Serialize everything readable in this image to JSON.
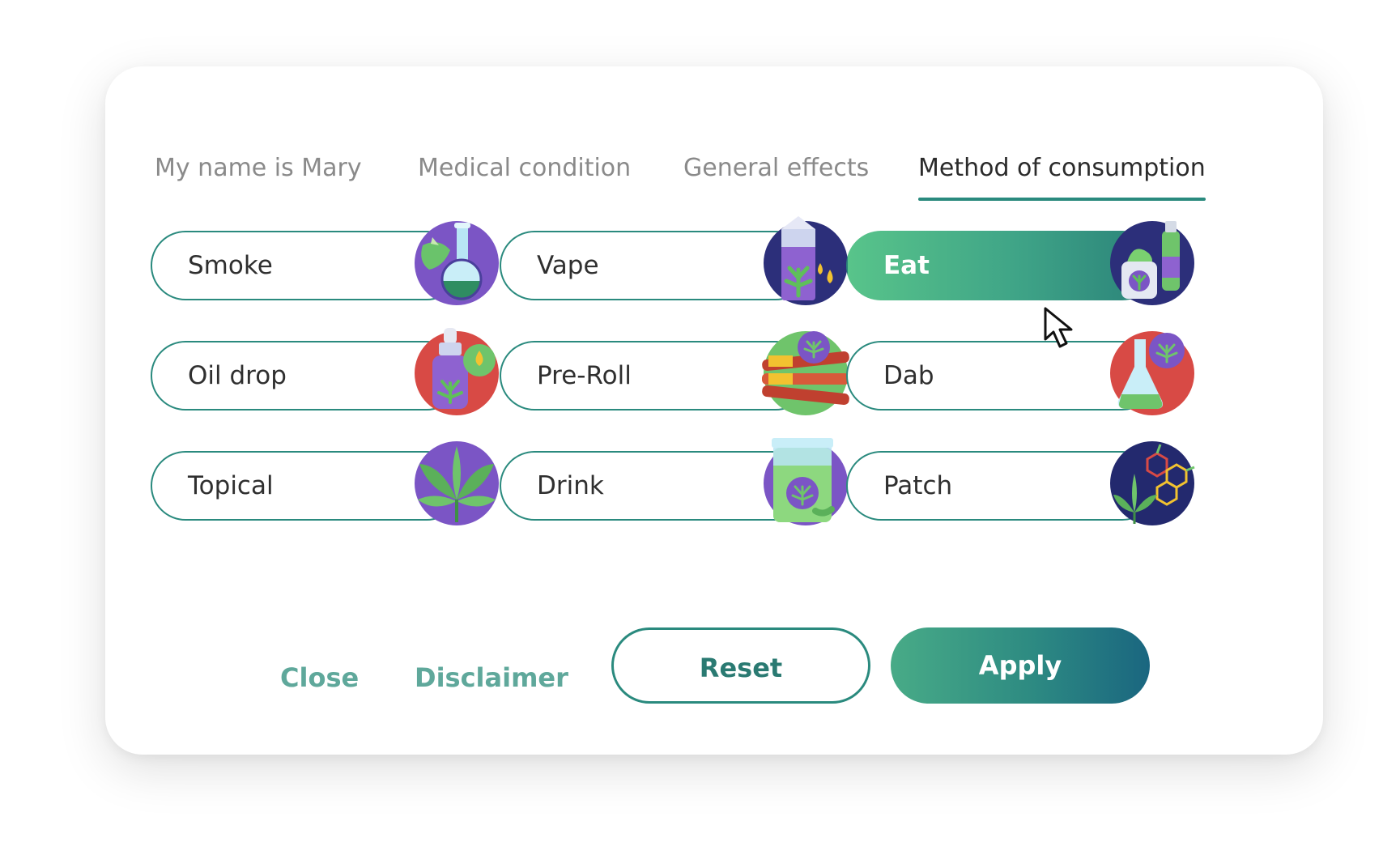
{
  "tabs": [
    {
      "label": "My name is Mary",
      "active": false
    },
    {
      "label": "Medical condition",
      "active": false
    },
    {
      "label": "General effects",
      "active": false
    },
    {
      "label": "Method of consumption",
      "active": true
    }
  ],
  "options": [
    {
      "label": "Smoke",
      "icon": "bong-icon",
      "selected": false
    },
    {
      "label": "Vape",
      "icon": "vape-cartridge-icon",
      "selected": false
    },
    {
      "label": "Eat",
      "icon": "edible-jar-icon",
      "selected": true
    },
    {
      "label": "Oil drop",
      "icon": "oil-dropper-icon",
      "selected": false
    },
    {
      "label": "Pre-Roll",
      "icon": "pre-roll-icon",
      "selected": false
    },
    {
      "label": "Dab",
      "icon": "dab-flask-icon",
      "selected": false
    },
    {
      "label": "Topical",
      "icon": "cannabis-leaf-icon",
      "selected": false
    },
    {
      "label": "Drink",
      "icon": "drink-bottle-icon",
      "selected": false
    },
    {
      "label": "Patch",
      "icon": "molecule-patch-icon",
      "selected": false
    }
  ],
  "footer": {
    "close_label": "Close",
    "disclaimer_label": "Disclaimer",
    "reset_label": "Reset",
    "apply_label": "Apply"
  },
  "colors": {
    "accent": "#2a8a7e",
    "selected_gradient_start": "#58c48a",
    "apply_gradient_end": "#1a6680",
    "link": "#5fa89b"
  }
}
